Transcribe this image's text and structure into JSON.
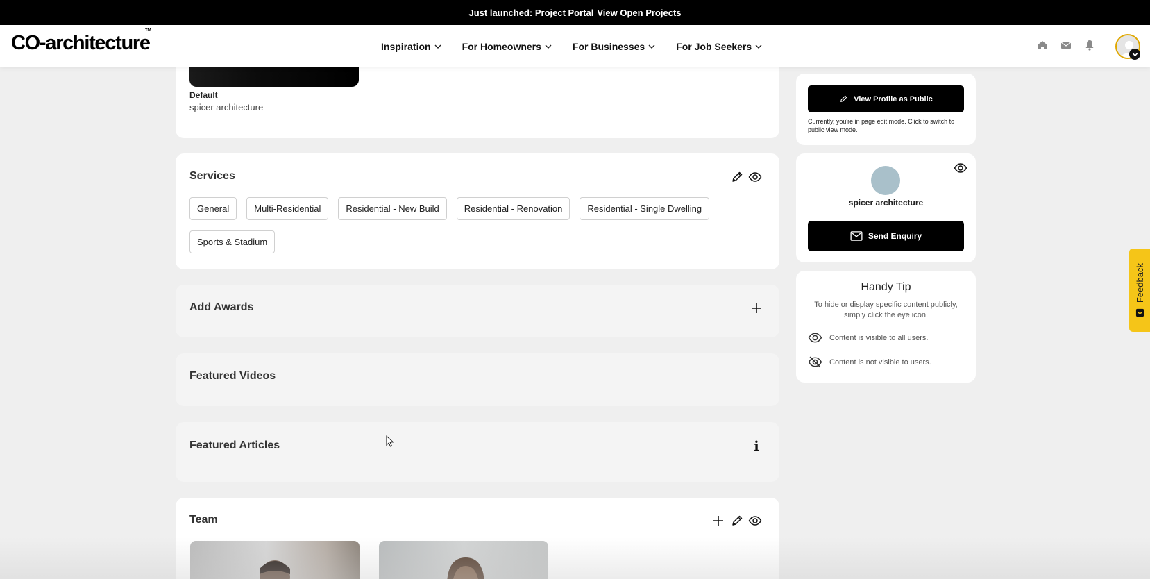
{
  "announcement": {
    "prefix": "Just launched: Project Portal",
    "link": "View Open Projects"
  },
  "nav": {
    "logo": "CO-architecture",
    "logo_mark": "™",
    "menu": [
      "Inspiration",
      "For Homeowners",
      "For Businesses",
      "For Job Seekers"
    ],
    "icons": [
      "home-icon",
      "mail-icon",
      "bell-icon"
    ]
  },
  "profile": {
    "default_label": "Default",
    "default_value": "spicer architecture"
  },
  "services": {
    "title": "Services",
    "items": [
      "General",
      "Multi-Residential",
      "Residential - New Build",
      "Residential - Renovation",
      "Residential - Single Dwelling",
      "Sports & Stadium"
    ]
  },
  "awards": {
    "title": "Add Awards"
  },
  "videos": {
    "title": "Featured Videos"
  },
  "articles": {
    "title": "Featured Articles",
    "info_glyph": "i"
  },
  "team": {
    "title": "Team"
  },
  "sidebar": {
    "view_public_label": "View Profile as Public",
    "edit_mode_note": "Currently, you're in page edit mode. Click to switch to public view mode.",
    "company_name": "spicer architecture",
    "send_enquiry_label": "Send Enquiry",
    "tip": {
      "title": "Handy Tip",
      "body": "To hide or display specific content publicly, simply click the eye icon.",
      "visible_text": "Content is visible to all users.",
      "hidden_text": "Content is not visible to users."
    }
  },
  "feedback": {
    "label": "Feedback"
  },
  "colors": {
    "accent": "#f5c518",
    "primary": "#000000",
    "page_bg": "#efefef"
  }
}
